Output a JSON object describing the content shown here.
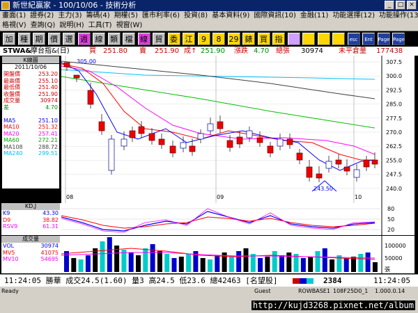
{
  "window": {
    "title": "新世紀贏家 - 100/10/06 - 技術分析"
  },
  "menu1": [
    "畫面(1)",
    "證券(2)",
    "主力(3)",
    "籌碼(4)",
    "期權(5)",
    "匯市利率(6)",
    "投資(8)",
    "基本資料(9)",
    "國際資訊(10)",
    "金融(11)",
    "功能選擇(12)",
    "功能操作(13)"
  ],
  "menu2": [
    "格視(V)",
    "查詢(Q)",
    "說明(H)",
    "工具(T)",
    "視窗(W)"
  ],
  "toolbar": [
    "加",
    "種",
    "期",
    "價",
    "選",
    "週",
    "線",
    "類",
    "檔",
    "線",
    "貿",
    "委",
    "江",
    "9",
    "8",
    "29",
    "錶",
    "買",
    "指",
    "",
    "",
    "",
    "",
    "esc",
    "Ent",
    "Page",
    "Page"
  ],
  "info": {
    "symbol": "STWA&",
    "name": "摩台指&(日)",
    "buy_label": "買",
    "buy": "251.80",
    "sell_label": "賣",
    "sell": "251.90",
    "deal_label": "成↑",
    "deal": "251.90",
    "change_label": "漲跌",
    "change": "4.70",
    "volume_label": "總張",
    "volume": "30974",
    "oi_label": "未平倉量",
    "oi": "177438"
  },
  "left": {
    "title": "K線圖",
    "date": "2011/10/06",
    "rows": [
      {
        "label": "開盤價",
        "value": "253.20"
      },
      {
        "label": "最高價",
        "value": "255.10"
      },
      {
        "label": "最低價",
        "value": "251.40"
      },
      {
        "label": "收盤價",
        "value": "251.90"
      },
      {
        "label": "成交量",
        "value": "30974"
      },
      {
        "label": "差",
        "value": "4.70"
      },
      {
        "label": "",
        "value": ""
      },
      {
        "label": "MA5",
        "value": "251.10"
      },
      {
        "label": "MA10",
        "value": "251.32"
      },
      {
        "label": "MA20",
        "value": "257.41"
      },
      {
        "label": "MA60",
        "value": "272.21"
      },
      {
        "label": "MA108",
        "value": "288.72"
      },
      {
        "label": "MA240",
        "value": "299.51"
      }
    ]
  },
  "kd": {
    "title": "KD,J",
    "rows": [
      {
        "label": "K9",
        "value": "43.30"
      },
      {
        "label": "D9",
        "value": "38.82"
      },
      {
        "label": "RSV9",
        "value": "61.31"
      }
    ],
    "ticks": [
      "80",
      "50",
      "20"
    ]
  },
  "vol": {
    "title": "成交量",
    "rows": [
      {
        "label": "VOL",
        "value": "30974"
      },
      {
        "label": "MV5",
        "value": "41075"
      },
      {
        "label": "MV10",
        "value": "54695"
      }
    ],
    "ticks": [
      "100000",
      "50000",
      "張"
    ]
  },
  "chart_labels": {
    "top": "305.00",
    "bottom": "243.50",
    "months": [
      "08",
      "09",
      "10"
    ],
    "yticks": [
      "307.5",
      "300.0",
      "292.5",
      "285.0",
      "277.5",
      "270.0",
      "262.5",
      "255.0",
      "247.5",
      "240.0"
    ]
  },
  "status": {
    "text": "11:24:05 勝華 成交24.5(1.60) 量3 高24.5 低23.6 總42463 [名望股]",
    "code": "2384",
    "time": "11:24:05"
  },
  "bottom": {
    "ready": "Ready",
    "guest": "Guest",
    "row": "ROWBASE1",
    "field": "108F25D0_1",
    "page": "1.000.0.14",
    "url": "http://kujd3268.pixnet.net/album"
  },
  "chart_data": {
    "type": "candlestick",
    "ylim": [
      240,
      307.5
    ],
    "ma5_color": "#0000ff",
    "ma10_color": "#ff0000",
    "ma20_color": "#ff00ff",
    "ma60_color": "#00c000",
    "ma108_color": "#404040",
    "ma240_color": "#00c0ff"
  }
}
